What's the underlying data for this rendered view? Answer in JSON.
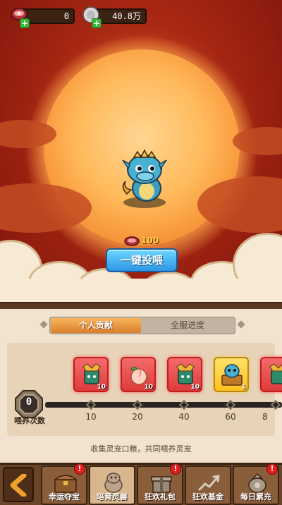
{
  "resources": {
    "meat": {
      "icon": "meat-icon",
      "value": "0"
    },
    "coin": {
      "icon": "silver-coin-icon",
      "value": "40.8万"
    }
  },
  "feed": {
    "cost_icon": "meat-icon",
    "cost": "100",
    "button_label": "一键投喂"
  },
  "tabs": {
    "active": "个人贡献",
    "inactive": "全服进度"
  },
  "progress": {
    "count": "0",
    "count_label": "喂养次数",
    "milestones": [
      "10",
      "20",
      "40",
      "60",
      "8"
    ],
    "rewards": [
      {
        "icon": "jade-totem-icon",
        "qty": "10",
        "style": "red"
      },
      {
        "icon": "peach-icon",
        "qty": "10",
        "style": "red"
      },
      {
        "icon": "jade-totem-icon",
        "qty": "10",
        "style": "red"
      },
      {
        "icon": "dragon-chest-icon",
        "qty": "1",
        "style": "gold"
      },
      {
        "icon": "jade-totem-icon",
        "qty": "",
        "style": "red"
      }
    ],
    "hint": "收集灵宠口粮，共同喂养灵宠"
  },
  "nav": {
    "items": [
      {
        "label": "幸运夺宝",
        "icon": "treasure-chest-icon",
        "alert": "!"
      },
      {
        "label": "培育灵兽",
        "icon": "beast-icon",
        "alert": ""
      },
      {
        "label": "狂欢礼包",
        "icon": "gift-box-icon",
        "alert": "!"
      },
      {
        "label": "狂欢基金",
        "icon": "fund-chart-icon",
        "alert": ""
      },
      {
        "label": "每日累充",
        "icon": "money-bag-icon",
        "alert": "!"
      }
    ]
  },
  "colors": {
    "sky": "#a52613",
    "sun": "#ffb95a",
    "feed_button": "#2c96e6",
    "tab_active": "#db7f2a",
    "panel": "#f1e3cf"
  }
}
